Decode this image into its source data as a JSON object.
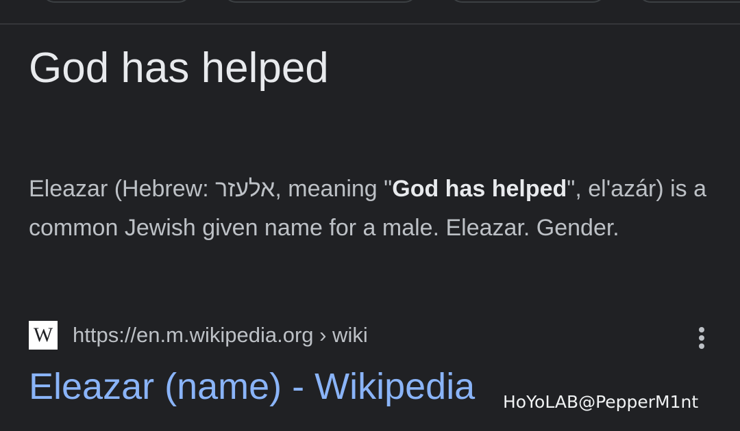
{
  "featured_answer": {
    "title": "God has helped"
  },
  "snippet": {
    "part1": "Eleazar (Hebrew: אלעזר, meaning \"",
    "bold": "God has helped",
    "part2": "\", el'azár) is a common Jewish given name for a male. Eleazar. Gender."
  },
  "source": {
    "favicon_letter": "W",
    "url": "https://en.m.wikipedia.org › wiki",
    "more_icon": "more-vert-icon"
  },
  "result": {
    "title": "Eleazar (name) - Wikipedia"
  },
  "watermark": {
    "text": "HoYoLAB@PepperM1nt"
  },
  "colors": {
    "background": "#202124",
    "title_text": "#e8eaed",
    "body_text": "#bdc1c6",
    "link": "#8ab4f8"
  }
}
